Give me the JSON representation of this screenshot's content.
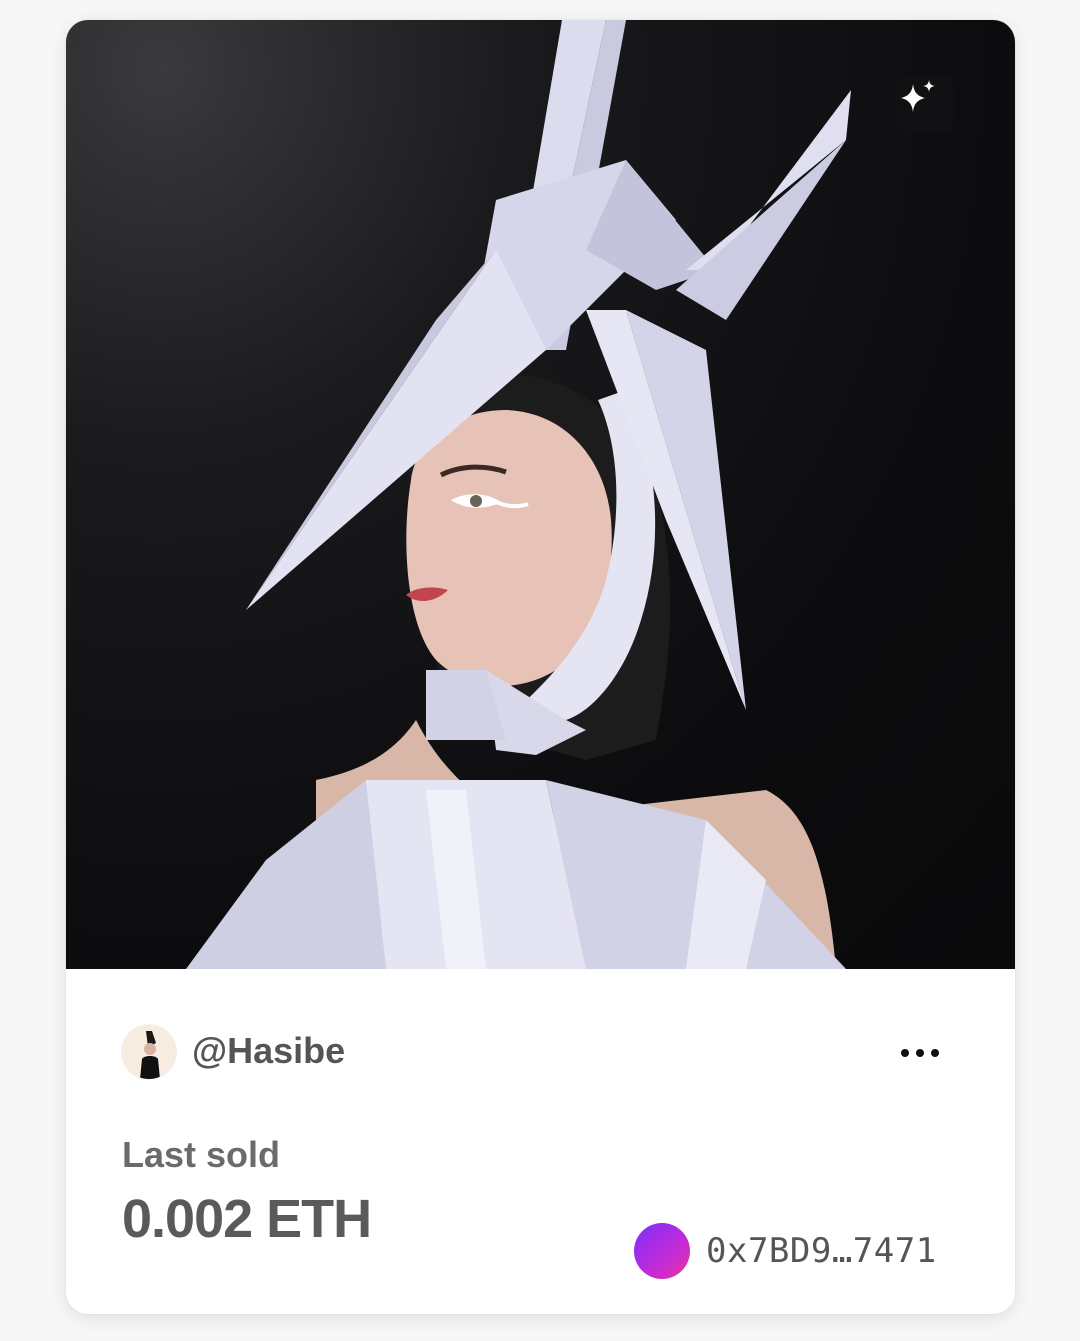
{
  "card": {
    "creator": {
      "username": "@Hasibe",
      "avatar_icon": "creator-avatar"
    },
    "ai_badge_icon": "sparkles-icon",
    "more_menu_icon": "more-horizontal-icon",
    "last_sold_label": "Last sold",
    "price": "0.002 ETH",
    "owner": {
      "address": "0x7BD9…7471",
      "avatar_gradient": [
        "#7b2ff7",
        "#c22bd8",
        "#e9349a"
      ]
    }
  }
}
